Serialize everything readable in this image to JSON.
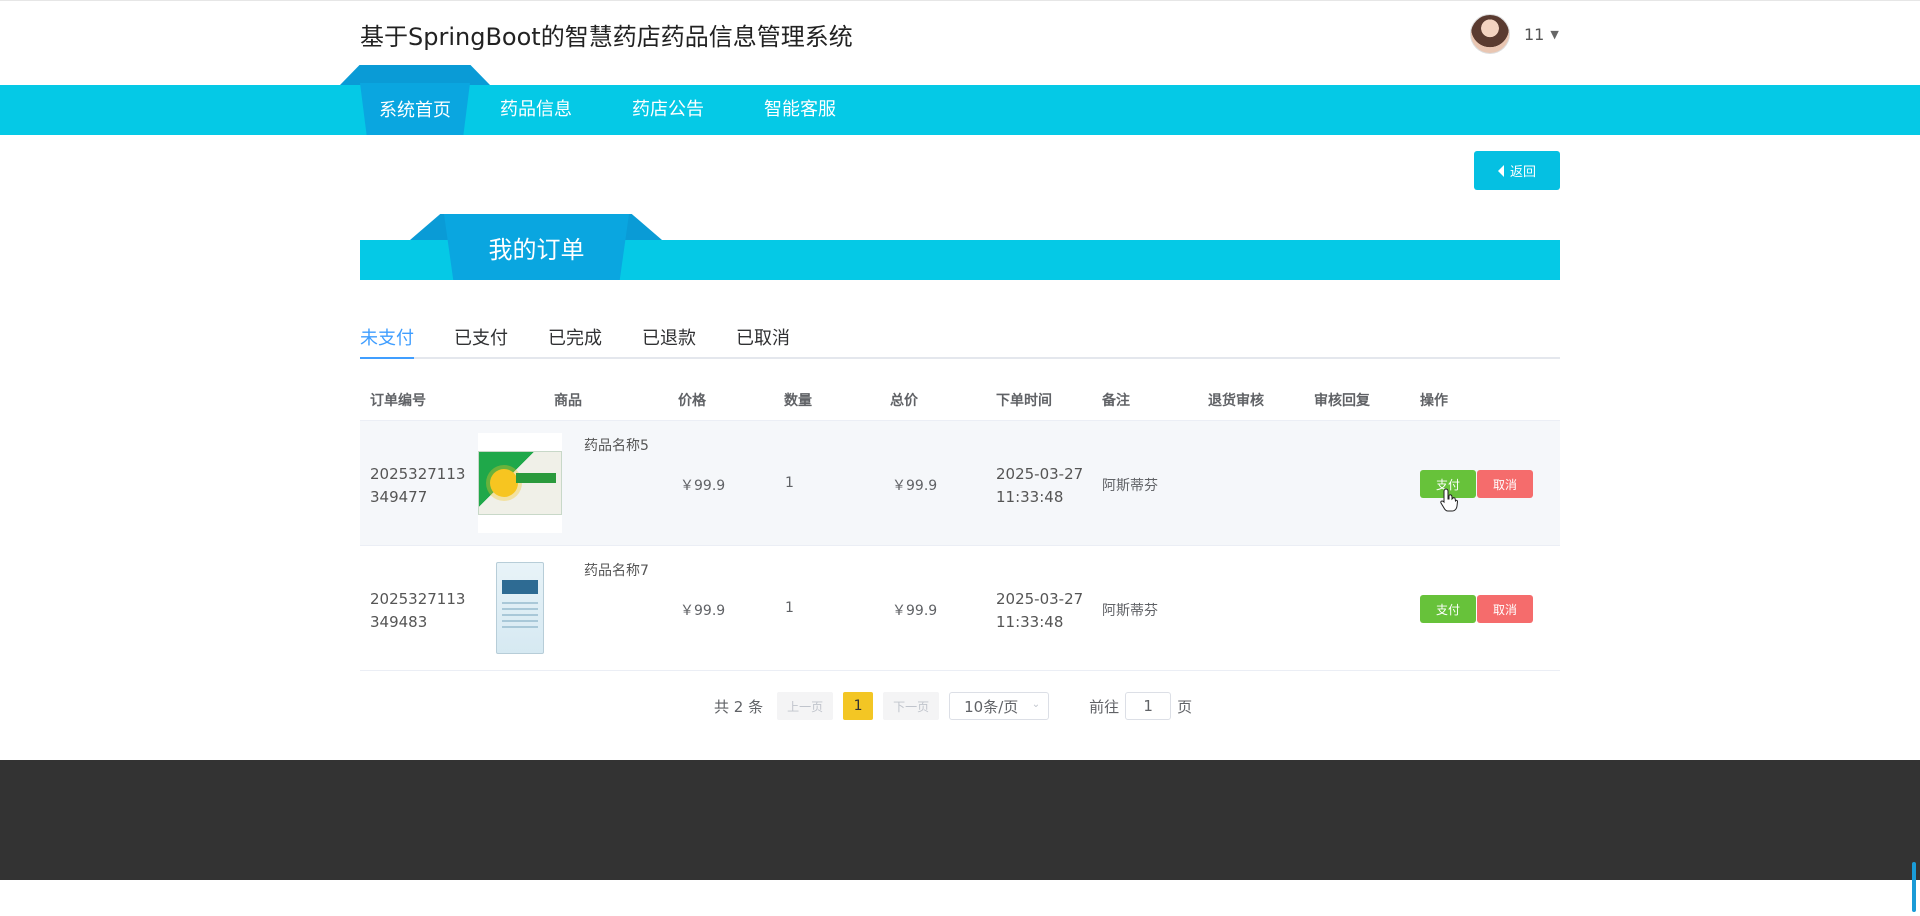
{
  "header": {
    "title": "基于SpringBoot的智慧药店药品信息管理系统",
    "user_name": "11",
    "caret": "▼"
  },
  "nav": {
    "items": [
      {
        "label": "系统首页"
      },
      {
        "label": "药品信息"
      },
      {
        "label": "药店公告"
      },
      {
        "label": "智能客服"
      }
    ],
    "active_index": 0
  },
  "back_button": {
    "label": "返回"
  },
  "section": {
    "title": "我的订单"
  },
  "status_tabs": [
    {
      "label": "未支付"
    },
    {
      "label": "已支付"
    },
    {
      "label": "已完成"
    },
    {
      "label": "已退款"
    },
    {
      "label": "已取消"
    }
  ],
  "table": {
    "columns": [
      "订单编号",
      "商品",
      "价格",
      "数量",
      "总价",
      "下单时间",
      "备注",
      "退货审核",
      "审核回复",
      "操作"
    ],
    "rows": [
      {
        "order_no_1": "2025327113",
        "order_no_2": "349477",
        "goods_name": "药品名称5",
        "price": "￥99.9",
        "qty": "1",
        "total": "￥99.9",
        "time_date": "2025-03-27",
        "time_clock": "11:33:48",
        "remark": "阿斯蒂芬",
        "return_review": "",
        "review_reply": "",
        "pay_label": "支付",
        "cancel_label": "取消"
      },
      {
        "order_no_1": "2025327113",
        "order_no_2": "349483",
        "goods_name": "药品名称7",
        "price": "￥99.9",
        "qty": "1",
        "total": "￥99.9",
        "time_date": "2025-03-27",
        "time_clock": "11:33:48",
        "remark": "阿斯蒂芬",
        "return_review": "",
        "review_reply": "",
        "pay_label": "支付",
        "cancel_label": "取消"
      }
    ]
  },
  "pagination": {
    "total_text": "共 2 条",
    "prev": "上一页",
    "current_page": "1",
    "next": "下一页",
    "page_size": "10条/页",
    "goto_prefix": "前往",
    "goto_value": "1",
    "goto_suffix": "页"
  },
  "colors": {
    "nav_bg": "#05c9e6",
    "accent_dark": "#0aa6e0",
    "pay_green": "#67c23a",
    "cancel_red": "#f56c6c",
    "active_tab_blue": "#409eff",
    "footer_bg": "#333333"
  }
}
